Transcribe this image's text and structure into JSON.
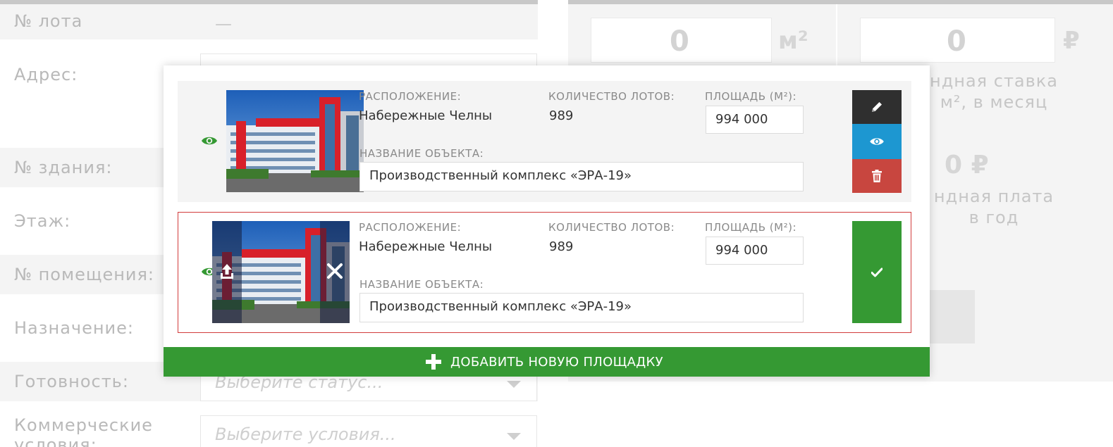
{
  "background_form": {
    "lot_label": "№ лота",
    "lot_value": "—",
    "address_label": "Адрес:",
    "building_label": "№ здания:",
    "floor_label": "Этаж:",
    "room_label": "№ помещения:",
    "purpose_label": "Назначение:",
    "readiness_label": "Готовность:",
    "readiness_placeholder": "Выберите статус...",
    "commercial_label_line1": "Коммерческие",
    "commercial_label_line2": "условия:",
    "commercial_placeholder": "Выберите условия..."
  },
  "summary_panel": {
    "area_value": "0",
    "area_unit": "м²",
    "rate_value": "0",
    "rate_unit": "₽",
    "rate_caption_line1": "ндная ставка",
    "rate_caption_line2": "м², в месяц",
    "yearly_value": "0 ₽",
    "yearly_caption_line1": "ндная плата",
    "yearly_caption_line2": "в год"
  },
  "modal": {
    "sites": [
      {
        "location_label": "Расположение:",
        "location_value": "Набережные Челны",
        "lots_label": "Количество лотов:",
        "lots_value": "989",
        "area_label": "Площадь (м²):",
        "area_value": "994 000",
        "name_label": "Название объекта:",
        "name_value": "Производственный комплекс «ЭРА-19»",
        "icons": [
          "eye-icon",
          "pencil-icon",
          "eye-icon",
          "trash-icon"
        ]
      },
      {
        "location_label": "Расположение:",
        "location_value": "Набережные Челны",
        "lots_label": "Количество лотов:",
        "lots_value": "989",
        "area_label": "Площадь (м²):",
        "area_value": "994 000",
        "name_label": "Название объекта:",
        "name_value": "Производственный комплекс «ЭРА-19»",
        "icons": [
          "eye-icon",
          "upload-icon",
          "close-icon",
          "check-icon"
        ]
      }
    ],
    "add_button_label": "ДОБАВИТЬ НОВУЮ ПЛОЩАДКУ"
  },
  "colors": {
    "accent_green": "#359933",
    "edit_dark": "#2f2f2f",
    "view_blue": "#1d97d1",
    "delete_red": "#c8463f",
    "editing_border": "#d23c3c"
  }
}
